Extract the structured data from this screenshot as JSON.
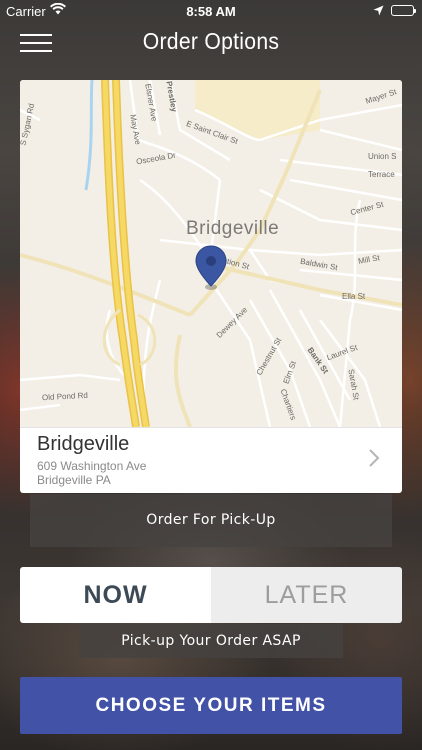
{
  "status_bar": {
    "carrier": "Carrier",
    "time": "8:58 AM",
    "icons": [
      "wifi-icon",
      "location-arrow-icon",
      "battery-icon"
    ]
  },
  "nav": {
    "title": "Order Options",
    "menu_icon": "hamburger-menu-icon"
  },
  "map": {
    "city_label": "Bridgeville",
    "streets": {
      "sygan": "S Sygan Rd",
      "may": "May Ave",
      "elsner": "Elsner Ave",
      "prestley": "Prestley",
      "st_clair": "E Saint Clair St",
      "mayer": "Mayer St",
      "union": "Union S",
      "terrace": "Terrace",
      "center": "Center St",
      "osceola": "Osceola Dr",
      "station": "Station St",
      "baldwin": "Baldwin St",
      "mill": "Mill St",
      "ella": "Ella St",
      "dewey": "Dewey Ave",
      "chestnut": "Chestnut St",
      "elm": "Elm St",
      "bank": "Bank St",
      "laurel": "Laurel St",
      "sarah": "Sarah St",
      "chartiers": "Chartiers",
      "old_pond": "Old Pond Rd"
    },
    "pin_icon": "map-pin-icon"
  },
  "location": {
    "name": "Bridgeville",
    "address_line1": "609 Washington Ave",
    "address_line2": "Bridgeville PA"
  },
  "order_type_label": "Order For Pick-Up",
  "timing": {
    "options": [
      "NOW",
      "LATER"
    ],
    "selected": "NOW"
  },
  "timing_note": "Pick-up Your Order ASAP",
  "cta_label": "CHOOSE YOUR ITEMS",
  "colors": {
    "cta": "#4252a6",
    "pin": "#3b57a4",
    "highway": "#f5d25a"
  }
}
